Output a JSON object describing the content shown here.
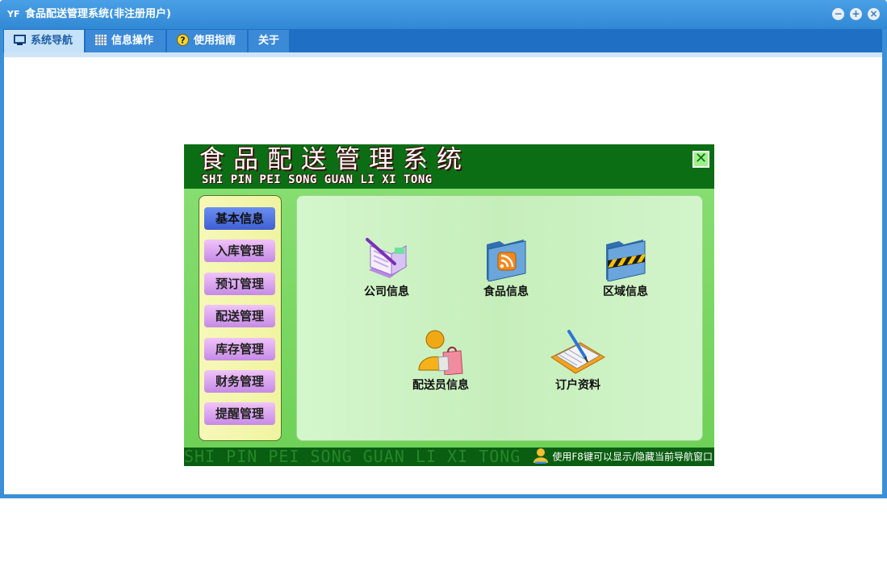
{
  "window": {
    "title": "食品配送管理系统(非注册用户)",
    "app_icon": "YF",
    "controls": [
      "minimize-icon",
      "restore-icon",
      "close-icon"
    ]
  },
  "menubar": {
    "tabs": [
      {
        "label": "系统导航",
        "icon": "monitor-icon",
        "active": true
      },
      {
        "label": "信息操作",
        "icon": "grid-icon",
        "active": false
      },
      {
        "label": "使用指南",
        "icon": "help-icon",
        "active": false
      },
      {
        "label": "关于",
        "icon": "",
        "active": false
      }
    ]
  },
  "nav_panel": {
    "title_cn": "食品配送管理系统",
    "title_pinyin": "SHI PIN PEI SONG GUAN LI XI TONG",
    "close_label": "✕",
    "sidebar": [
      {
        "label": "基本信息",
        "active": true
      },
      {
        "label": "入库管理",
        "active": false
      },
      {
        "label": "预订管理",
        "active": false
      },
      {
        "label": "配送管理",
        "active": false
      },
      {
        "label": "库存管理",
        "active": false
      },
      {
        "label": "财务管理",
        "active": false
      },
      {
        "label": "提醒管理",
        "active": false
      }
    ],
    "modules": [
      {
        "label": "公司信息",
        "icon": "document-pen-icon"
      },
      {
        "label": "食品信息",
        "icon": "rss-folder-icon"
      },
      {
        "label": "区域信息",
        "icon": "caution-folder-icon"
      },
      {
        "label": "配送员信息",
        "icon": "user-shopping-icon"
      },
      {
        "label": "订户资料",
        "icon": "notebook-pen-icon"
      }
    ],
    "footer_watermark": "SHI PIN PEI SONG GUAN LI XI TONG",
    "footer_hint": "使用F8键可以显示/隐藏当前导航窗口"
  },
  "colors": {
    "title_bar": "#3b8fd6",
    "menubar": "#1f6fc5",
    "header_green": "#0b6e14",
    "panel_green": "#7fd86a",
    "sidebar_active": "#3f5fd4",
    "sidebar_button": "#c58ae6"
  }
}
